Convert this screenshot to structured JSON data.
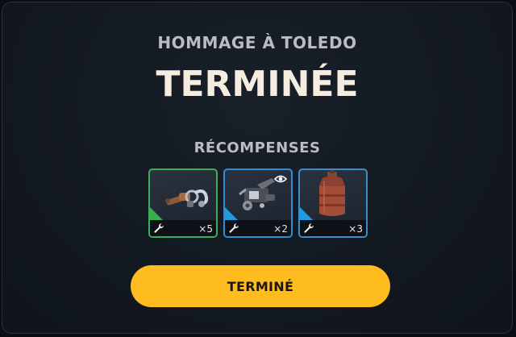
{
  "dialog": {
    "subtitle": "HOMMAGE À TOLEDO",
    "title": "TERMINÉE",
    "rewards_label": "RÉCOMPENSES",
    "button_label": "TERMINÉ"
  },
  "rewards": [
    {
      "quantity": "×5",
      "rarity_color": "#3fae5c",
      "icon": "pipe-fittings-icon",
      "type_icon": "wrench-icon",
      "has_eye": false
    },
    {
      "quantity": "×2",
      "rarity_color": "#2e8fd6",
      "icon": "mechanical-parts-icon",
      "type_icon": "wrench-icon",
      "has_eye": true
    },
    {
      "quantity": "×3",
      "rarity_color": "#3b8fc9",
      "icon": "gas-canister-icon",
      "type_icon": "wrench-icon",
      "has_eye": false
    }
  ],
  "colors": {
    "accent_button": "#ffbc1f",
    "title_color": "#f6ecdf",
    "panel_background": "#141a22"
  }
}
